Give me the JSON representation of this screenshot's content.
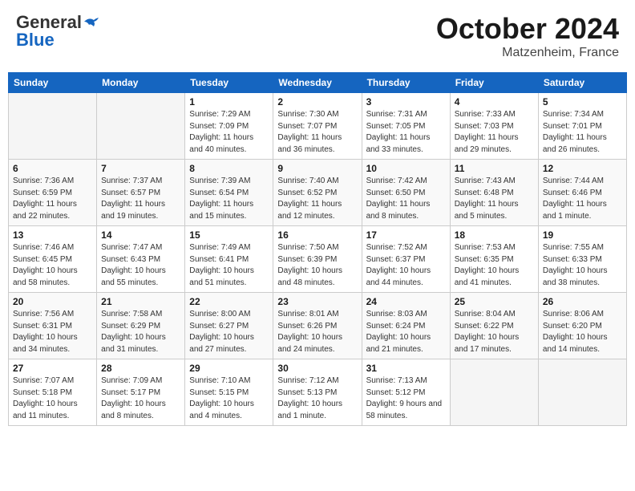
{
  "header": {
    "logo_general": "General",
    "logo_blue": "Blue",
    "month_title": "October 2024",
    "location": "Matzenheim, France"
  },
  "weekdays": [
    "Sunday",
    "Monday",
    "Tuesday",
    "Wednesday",
    "Thursday",
    "Friday",
    "Saturday"
  ],
  "weeks": [
    [
      {
        "day": "",
        "sunrise": "",
        "sunset": "",
        "daylight": ""
      },
      {
        "day": "",
        "sunrise": "",
        "sunset": "",
        "daylight": ""
      },
      {
        "day": "1",
        "sunrise": "Sunrise: 7:29 AM",
        "sunset": "Sunset: 7:09 PM",
        "daylight": "Daylight: 11 hours and 40 minutes."
      },
      {
        "day": "2",
        "sunrise": "Sunrise: 7:30 AM",
        "sunset": "Sunset: 7:07 PM",
        "daylight": "Daylight: 11 hours and 36 minutes."
      },
      {
        "day": "3",
        "sunrise": "Sunrise: 7:31 AM",
        "sunset": "Sunset: 7:05 PM",
        "daylight": "Daylight: 11 hours and 33 minutes."
      },
      {
        "day": "4",
        "sunrise": "Sunrise: 7:33 AM",
        "sunset": "Sunset: 7:03 PM",
        "daylight": "Daylight: 11 hours and 29 minutes."
      },
      {
        "day": "5",
        "sunrise": "Sunrise: 7:34 AM",
        "sunset": "Sunset: 7:01 PM",
        "daylight": "Daylight: 11 hours and 26 minutes."
      }
    ],
    [
      {
        "day": "6",
        "sunrise": "Sunrise: 7:36 AM",
        "sunset": "Sunset: 6:59 PM",
        "daylight": "Daylight: 11 hours and 22 minutes."
      },
      {
        "day": "7",
        "sunrise": "Sunrise: 7:37 AM",
        "sunset": "Sunset: 6:57 PM",
        "daylight": "Daylight: 11 hours and 19 minutes."
      },
      {
        "day": "8",
        "sunrise": "Sunrise: 7:39 AM",
        "sunset": "Sunset: 6:54 PM",
        "daylight": "Daylight: 11 hours and 15 minutes."
      },
      {
        "day": "9",
        "sunrise": "Sunrise: 7:40 AM",
        "sunset": "Sunset: 6:52 PM",
        "daylight": "Daylight: 11 hours and 12 minutes."
      },
      {
        "day": "10",
        "sunrise": "Sunrise: 7:42 AM",
        "sunset": "Sunset: 6:50 PM",
        "daylight": "Daylight: 11 hours and 8 minutes."
      },
      {
        "day": "11",
        "sunrise": "Sunrise: 7:43 AM",
        "sunset": "Sunset: 6:48 PM",
        "daylight": "Daylight: 11 hours and 5 minutes."
      },
      {
        "day": "12",
        "sunrise": "Sunrise: 7:44 AM",
        "sunset": "Sunset: 6:46 PM",
        "daylight": "Daylight: 11 hours and 1 minute."
      }
    ],
    [
      {
        "day": "13",
        "sunrise": "Sunrise: 7:46 AM",
        "sunset": "Sunset: 6:45 PM",
        "daylight": "Daylight: 10 hours and 58 minutes."
      },
      {
        "day": "14",
        "sunrise": "Sunrise: 7:47 AM",
        "sunset": "Sunset: 6:43 PM",
        "daylight": "Daylight: 10 hours and 55 minutes."
      },
      {
        "day": "15",
        "sunrise": "Sunrise: 7:49 AM",
        "sunset": "Sunset: 6:41 PM",
        "daylight": "Daylight: 10 hours and 51 minutes."
      },
      {
        "day": "16",
        "sunrise": "Sunrise: 7:50 AM",
        "sunset": "Sunset: 6:39 PM",
        "daylight": "Daylight: 10 hours and 48 minutes."
      },
      {
        "day": "17",
        "sunrise": "Sunrise: 7:52 AM",
        "sunset": "Sunset: 6:37 PM",
        "daylight": "Daylight: 10 hours and 44 minutes."
      },
      {
        "day": "18",
        "sunrise": "Sunrise: 7:53 AM",
        "sunset": "Sunset: 6:35 PM",
        "daylight": "Daylight: 10 hours and 41 minutes."
      },
      {
        "day": "19",
        "sunrise": "Sunrise: 7:55 AM",
        "sunset": "Sunset: 6:33 PM",
        "daylight": "Daylight: 10 hours and 38 minutes."
      }
    ],
    [
      {
        "day": "20",
        "sunrise": "Sunrise: 7:56 AM",
        "sunset": "Sunset: 6:31 PM",
        "daylight": "Daylight: 10 hours and 34 minutes."
      },
      {
        "day": "21",
        "sunrise": "Sunrise: 7:58 AM",
        "sunset": "Sunset: 6:29 PM",
        "daylight": "Daylight: 10 hours and 31 minutes."
      },
      {
        "day": "22",
        "sunrise": "Sunrise: 8:00 AM",
        "sunset": "Sunset: 6:27 PM",
        "daylight": "Daylight: 10 hours and 27 minutes."
      },
      {
        "day": "23",
        "sunrise": "Sunrise: 8:01 AM",
        "sunset": "Sunset: 6:26 PM",
        "daylight": "Daylight: 10 hours and 24 minutes."
      },
      {
        "day": "24",
        "sunrise": "Sunrise: 8:03 AM",
        "sunset": "Sunset: 6:24 PM",
        "daylight": "Daylight: 10 hours and 21 minutes."
      },
      {
        "day": "25",
        "sunrise": "Sunrise: 8:04 AM",
        "sunset": "Sunset: 6:22 PM",
        "daylight": "Daylight: 10 hours and 17 minutes."
      },
      {
        "day": "26",
        "sunrise": "Sunrise: 8:06 AM",
        "sunset": "Sunset: 6:20 PM",
        "daylight": "Daylight: 10 hours and 14 minutes."
      }
    ],
    [
      {
        "day": "27",
        "sunrise": "Sunrise: 7:07 AM",
        "sunset": "Sunset: 5:18 PM",
        "daylight": "Daylight: 10 hours and 11 minutes."
      },
      {
        "day": "28",
        "sunrise": "Sunrise: 7:09 AM",
        "sunset": "Sunset: 5:17 PM",
        "daylight": "Daylight: 10 hours and 8 minutes."
      },
      {
        "day": "29",
        "sunrise": "Sunrise: 7:10 AM",
        "sunset": "Sunset: 5:15 PM",
        "daylight": "Daylight: 10 hours and 4 minutes."
      },
      {
        "day": "30",
        "sunrise": "Sunrise: 7:12 AM",
        "sunset": "Sunset: 5:13 PM",
        "daylight": "Daylight: 10 hours and 1 minute."
      },
      {
        "day": "31",
        "sunrise": "Sunrise: 7:13 AM",
        "sunset": "Sunset: 5:12 PM",
        "daylight": "Daylight: 9 hours and 58 minutes."
      },
      {
        "day": "",
        "sunrise": "",
        "sunset": "",
        "daylight": ""
      },
      {
        "day": "",
        "sunrise": "",
        "sunset": "",
        "daylight": ""
      }
    ]
  ]
}
